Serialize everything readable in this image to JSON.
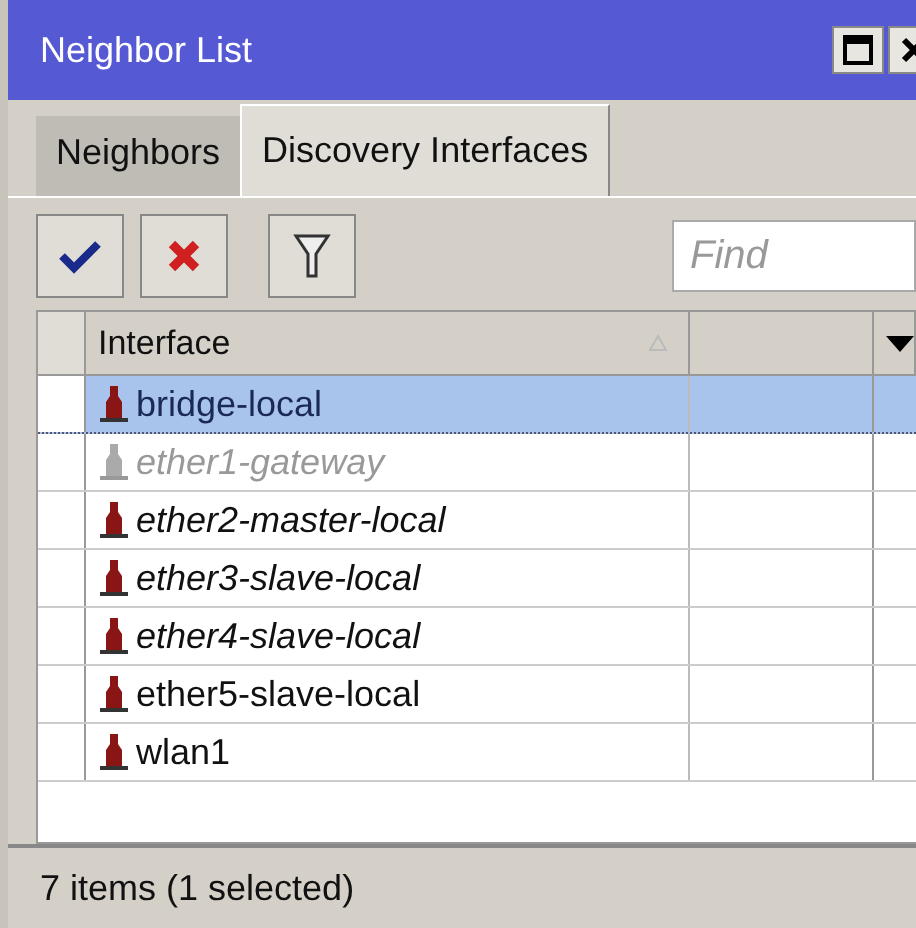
{
  "window": {
    "title": "Neighbor List"
  },
  "tabs": [
    {
      "label": "Neighbors",
      "selected": false
    },
    {
      "label": "Discovery Interfaces",
      "selected": true
    }
  ],
  "search": {
    "placeholder": "Find"
  },
  "table": {
    "columns": [
      "Interface"
    ],
    "rows": [
      {
        "name": "bridge-local",
        "selected": true,
        "disabled": false,
        "italic": false
      },
      {
        "name": "ether1-gateway",
        "selected": false,
        "disabled": true,
        "italic": true
      },
      {
        "name": "ether2-master-local",
        "selected": false,
        "disabled": false,
        "italic": true
      },
      {
        "name": "ether3-slave-local",
        "selected": false,
        "disabled": false,
        "italic": true
      },
      {
        "name": "ether4-slave-local",
        "selected": false,
        "disabled": false,
        "italic": true
      },
      {
        "name": "ether5-slave-local",
        "selected": false,
        "disabled": false,
        "italic": false
      },
      {
        "name": "wlan1",
        "selected": false,
        "disabled": false,
        "italic": false
      }
    ]
  },
  "status_bar": "7 items (1 selected)"
}
